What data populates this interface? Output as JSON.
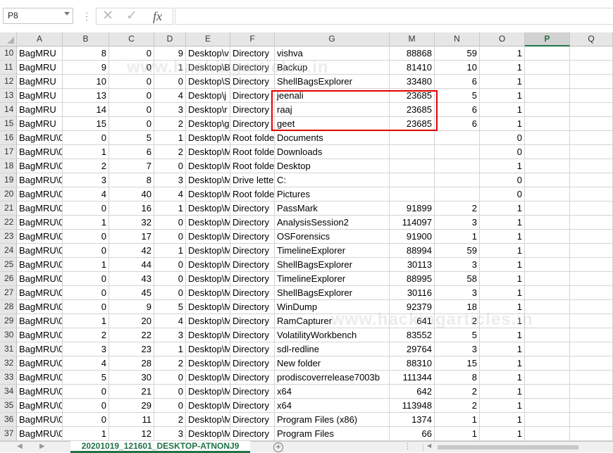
{
  "name_box": {
    "value": "P8"
  },
  "formula_bar": {
    "cancel_glyph": "✕",
    "enter_glyph": "✓",
    "fx_label": "fx",
    "value": ""
  },
  "columns": [
    "A",
    "B",
    "C",
    "D",
    "E",
    "F",
    "G",
    "M",
    "N",
    "O",
    "P",
    "Q"
  ],
  "selected_column": "P",
  "rows": [
    {
      "n": "10",
      "A": "BagMRU",
      "B": "8",
      "C": "0",
      "D": "9",
      "E": "Desktop\\v",
      "F": "Directory",
      "G": "vishva",
      "M": "88868",
      "N": "59",
      "O": "1"
    },
    {
      "n": "11",
      "A": "BagMRU",
      "B": "9",
      "C": "0",
      "D": "1",
      "E": "Desktop\\B",
      "F": "Directory",
      "G": "Backup",
      "M": "81410",
      "N": "10",
      "O": "1"
    },
    {
      "n": "12",
      "A": "BagMRU",
      "B": "10",
      "C": "0",
      "D": "0",
      "E": "Desktop\\S",
      "F": "Directory",
      "G": "ShellBagsExplorer",
      "M": "33480",
      "N": "6",
      "O": "1"
    },
    {
      "n": "13",
      "A": "BagMRU",
      "B": "13",
      "C": "0",
      "D": "4",
      "E": "Desktop\\j",
      "F": "Directory",
      "G": "jeenali",
      "M": "23685",
      "N": "5",
      "O": "1"
    },
    {
      "n": "14",
      "A": "BagMRU",
      "B": "14",
      "C": "0",
      "D": "3",
      "E": "Desktop\\r",
      "F": "Directory",
      "G": "raaj",
      "M": "23685",
      "N": "6",
      "O": "1"
    },
    {
      "n": "15",
      "A": "BagMRU",
      "B": "15",
      "C": "0",
      "D": "2",
      "E": "Desktop\\g",
      "F": "Directory",
      "G": "geet",
      "M": "23685",
      "N": "6",
      "O": "1"
    },
    {
      "n": "16",
      "A": "BagMRU\\0",
      "B": "0",
      "C": "5",
      "D": "1",
      "E": "Desktop\\M",
      "F": "Root folde",
      "G": "Documents",
      "M": "",
      "N": "",
      "O": "0"
    },
    {
      "n": "17",
      "A": "BagMRU\\0",
      "B": "1",
      "C": "6",
      "D": "2",
      "E": "Desktop\\M",
      "F": "Root folde",
      "G": "Downloads",
      "M": "",
      "N": "",
      "O": "0"
    },
    {
      "n": "18",
      "A": "BagMRU\\0",
      "B": "2",
      "C": "7",
      "D": "0",
      "E": "Desktop\\M",
      "F": "Root folde",
      "G": "Desktop",
      "M": "",
      "N": "",
      "O": "1"
    },
    {
      "n": "19",
      "A": "BagMRU\\0",
      "B": "3",
      "C": "8",
      "D": "3",
      "E": "Desktop\\M",
      "F": "Drive lette",
      "G": "C:",
      "M": "",
      "N": "",
      "O": "0"
    },
    {
      "n": "20",
      "A": "BagMRU\\0",
      "B": "4",
      "C": "40",
      "D": "4",
      "E": "Desktop\\M",
      "F": "Root folde",
      "G": "Pictures",
      "M": "",
      "N": "",
      "O": "0"
    },
    {
      "n": "21",
      "A": "BagMRU\\0",
      "B": "0",
      "C": "16",
      "D": "1",
      "E": "Desktop\\M",
      "F": "Directory",
      "G": "PassMark",
      "M": "91899",
      "N": "2",
      "O": "1"
    },
    {
      "n": "22",
      "A": "BagMRU\\0",
      "B": "1",
      "C": "32",
      "D": "0",
      "E": "Desktop\\M",
      "F": "Directory",
      "G": "AnalysisSession2",
      "M": "114097",
      "N": "3",
      "O": "1"
    },
    {
      "n": "23",
      "A": "BagMRU\\0",
      "B": "0",
      "C": "17",
      "D": "0",
      "E": "Desktop\\M",
      "F": "Directory",
      "G": "OSForensics",
      "M": "91900",
      "N": "1",
      "O": "1"
    },
    {
      "n": "24",
      "A": "BagMRU\\0",
      "B": "0",
      "C": "42",
      "D": "1",
      "E": "Desktop\\M",
      "F": "Directory",
      "G": "TimelineExplorer",
      "M": "88994",
      "N": "59",
      "O": "1"
    },
    {
      "n": "25",
      "A": "BagMRU\\0",
      "B": "1",
      "C": "44",
      "D": "0",
      "E": "Desktop\\M",
      "F": "Directory",
      "G": "ShellBagsExplorer",
      "M": "30113",
      "N": "3",
      "O": "1"
    },
    {
      "n": "26",
      "A": "BagMRU\\0",
      "B": "0",
      "C": "43",
      "D": "0",
      "E": "Desktop\\M",
      "F": "Directory",
      "G": "TimelineExplorer",
      "M": "88995",
      "N": "58",
      "O": "1"
    },
    {
      "n": "27",
      "A": "BagMRU\\0",
      "B": "0",
      "C": "45",
      "D": "0",
      "E": "Desktop\\M",
      "F": "Directory",
      "G": "ShellBagsExplorer",
      "M": "30116",
      "N": "3",
      "O": "1"
    },
    {
      "n": "28",
      "A": "BagMRU\\0",
      "B": "0",
      "C": "9",
      "D": "5",
      "E": "Desktop\\M",
      "F": "Directory",
      "G": "WinDump",
      "M": "92379",
      "N": "18",
      "O": "1"
    },
    {
      "n": "29",
      "A": "BagMRU\\0",
      "B": "1",
      "C": "20",
      "D": "4",
      "E": "Desktop\\M",
      "F": "Directory",
      "G": "RamCapturer",
      "M": "641",
      "N": "2",
      "O": "1"
    },
    {
      "n": "30",
      "A": "BagMRU\\0",
      "B": "2",
      "C": "22",
      "D": "3",
      "E": "Desktop\\M",
      "F": "Directory",
      "G": "VolatilityWorkbench",
      "M": "83552",
      "N": "5",
      "O": "1"
    },
    {
      "n": "31",
      "A": "BagMRU\\0",
      "B": "3",
      "C": "23",
      "D": "1",
      "E": "Desktop\\M",
      "F": "Directory",
      "G": "sdl-redline",
      "M": "29764",
      "N": "3",
      "O": "1"
    },
    {
      "n": "32",
      "A": "BagMRU\\0",
      "B": "4",
      "C": "28",
      "D": "2",
      "E": "Desktop\\M",
      "F": "Directory",
      "G": "New folder",
      "M": "88310",
      "N": "15",
      "O": "1"
    },
    {
      "n": "33",
      "A": "BagMRU\\0",
      "B": "5",
      "C": "30",
      "D": "0",
      "E": "Desktop\\M",
      "F": "Directory",
      "G": "prodiscoverrelease7003b",
      "M": "111344",
      "N": "8",
      "O": "1"
    },
    {
      "n": "34",
      "A": "BagMRU\\0",
      "B": "0",
      "C": "21",
      "D": "0",
      "E": "Desktop\\M",
      "F": "Directory",
      "G": "x64",
      "M": "642",
      "N": "2",
      "O": "1"
    },
    {
      "n": "35",
      "A": "BagMRU\\0",
      "B": "0",
      "C": "29",
      "D": "0",
      "E": "Desktop\\M",
      "F": "Directory",
      "G": "x64",
      "M": "113948",
      "N": "2",
      "O": "1"
    },
    {
      "n": "36",
      "A": "BagMRU\\0",
      "B": "0",
      "C": "11",
      "D": "2",
      "E": "Desktop\\M",
      "F": "Directory",
      "G": "Program Files (x86)",
      "M": "1374",
      "N": "1",
      "O": "1"
    },
    {
      "n": "37",
      "A": "BagMRU\\0",
      "B": "1",
      "C": "12",
      "D": "3",
      "E": "Desktop\\M",
      "F": "Directory",
      "G": "Program Files",
      "M": "66",
      "N": "1",
      "O": "1"
    }
  ],
  "watermark": "www.hackingarticles.in",
  "sheet_tabs": {
    "active": "20201019_121601_DESKTOP-ATNONJ9",
    "add_glyph": "+",
    "dots": "⋮"
  },
  "colors": {
    "highlight_border": "#e00000",
    "accent": "#217346"
  }
}
